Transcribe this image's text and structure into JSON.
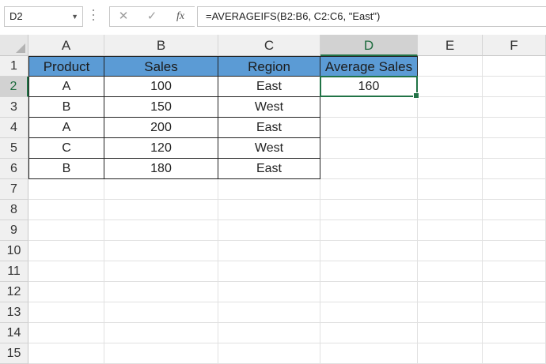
{
  "formula_bar": {
    "name_box": "D2",
    "cancel_icon": "✕",
    "enter_icon": "✓",
    "fx_label": "fx",
    "formula": "=AVERAGEIFS(B2:B6, C2:C6, \"East\")"
  },
  "columns": [
    "A",
    "B",
    "C",
    "D",
    "E",
    "F"
  ],
  "rows": [
    "1",
    "2",
    "3",
    "4",
    "5",
    "6",
    "7",
    "8",
    "9",
    "10",
    "11",
    "12",
    "13",
    "14",
    "15"
  ],
  "selected_cell": "D2",
  "table": {
    "headers": [
      "Product",
      "Sales",
      "Region"
    ],
    "rows": [
      [
        "A",
        "100",
        "East"
      ],
      [
        "B",
        "150",
        "West"
      ],
      [
        "A",
        "200",
        "East"
      ],
      [
        "C",
        "120",
        "West"
      ],
      [
        "B",
        "180",
        "East"
      ]
    ]
  },
  "result": {
    "header": "Average Sales",
    "value": "160"
  },
  "colors": {
    "header_fill": "#5b9bd5",
    "selection": "#217346"
  }
}
